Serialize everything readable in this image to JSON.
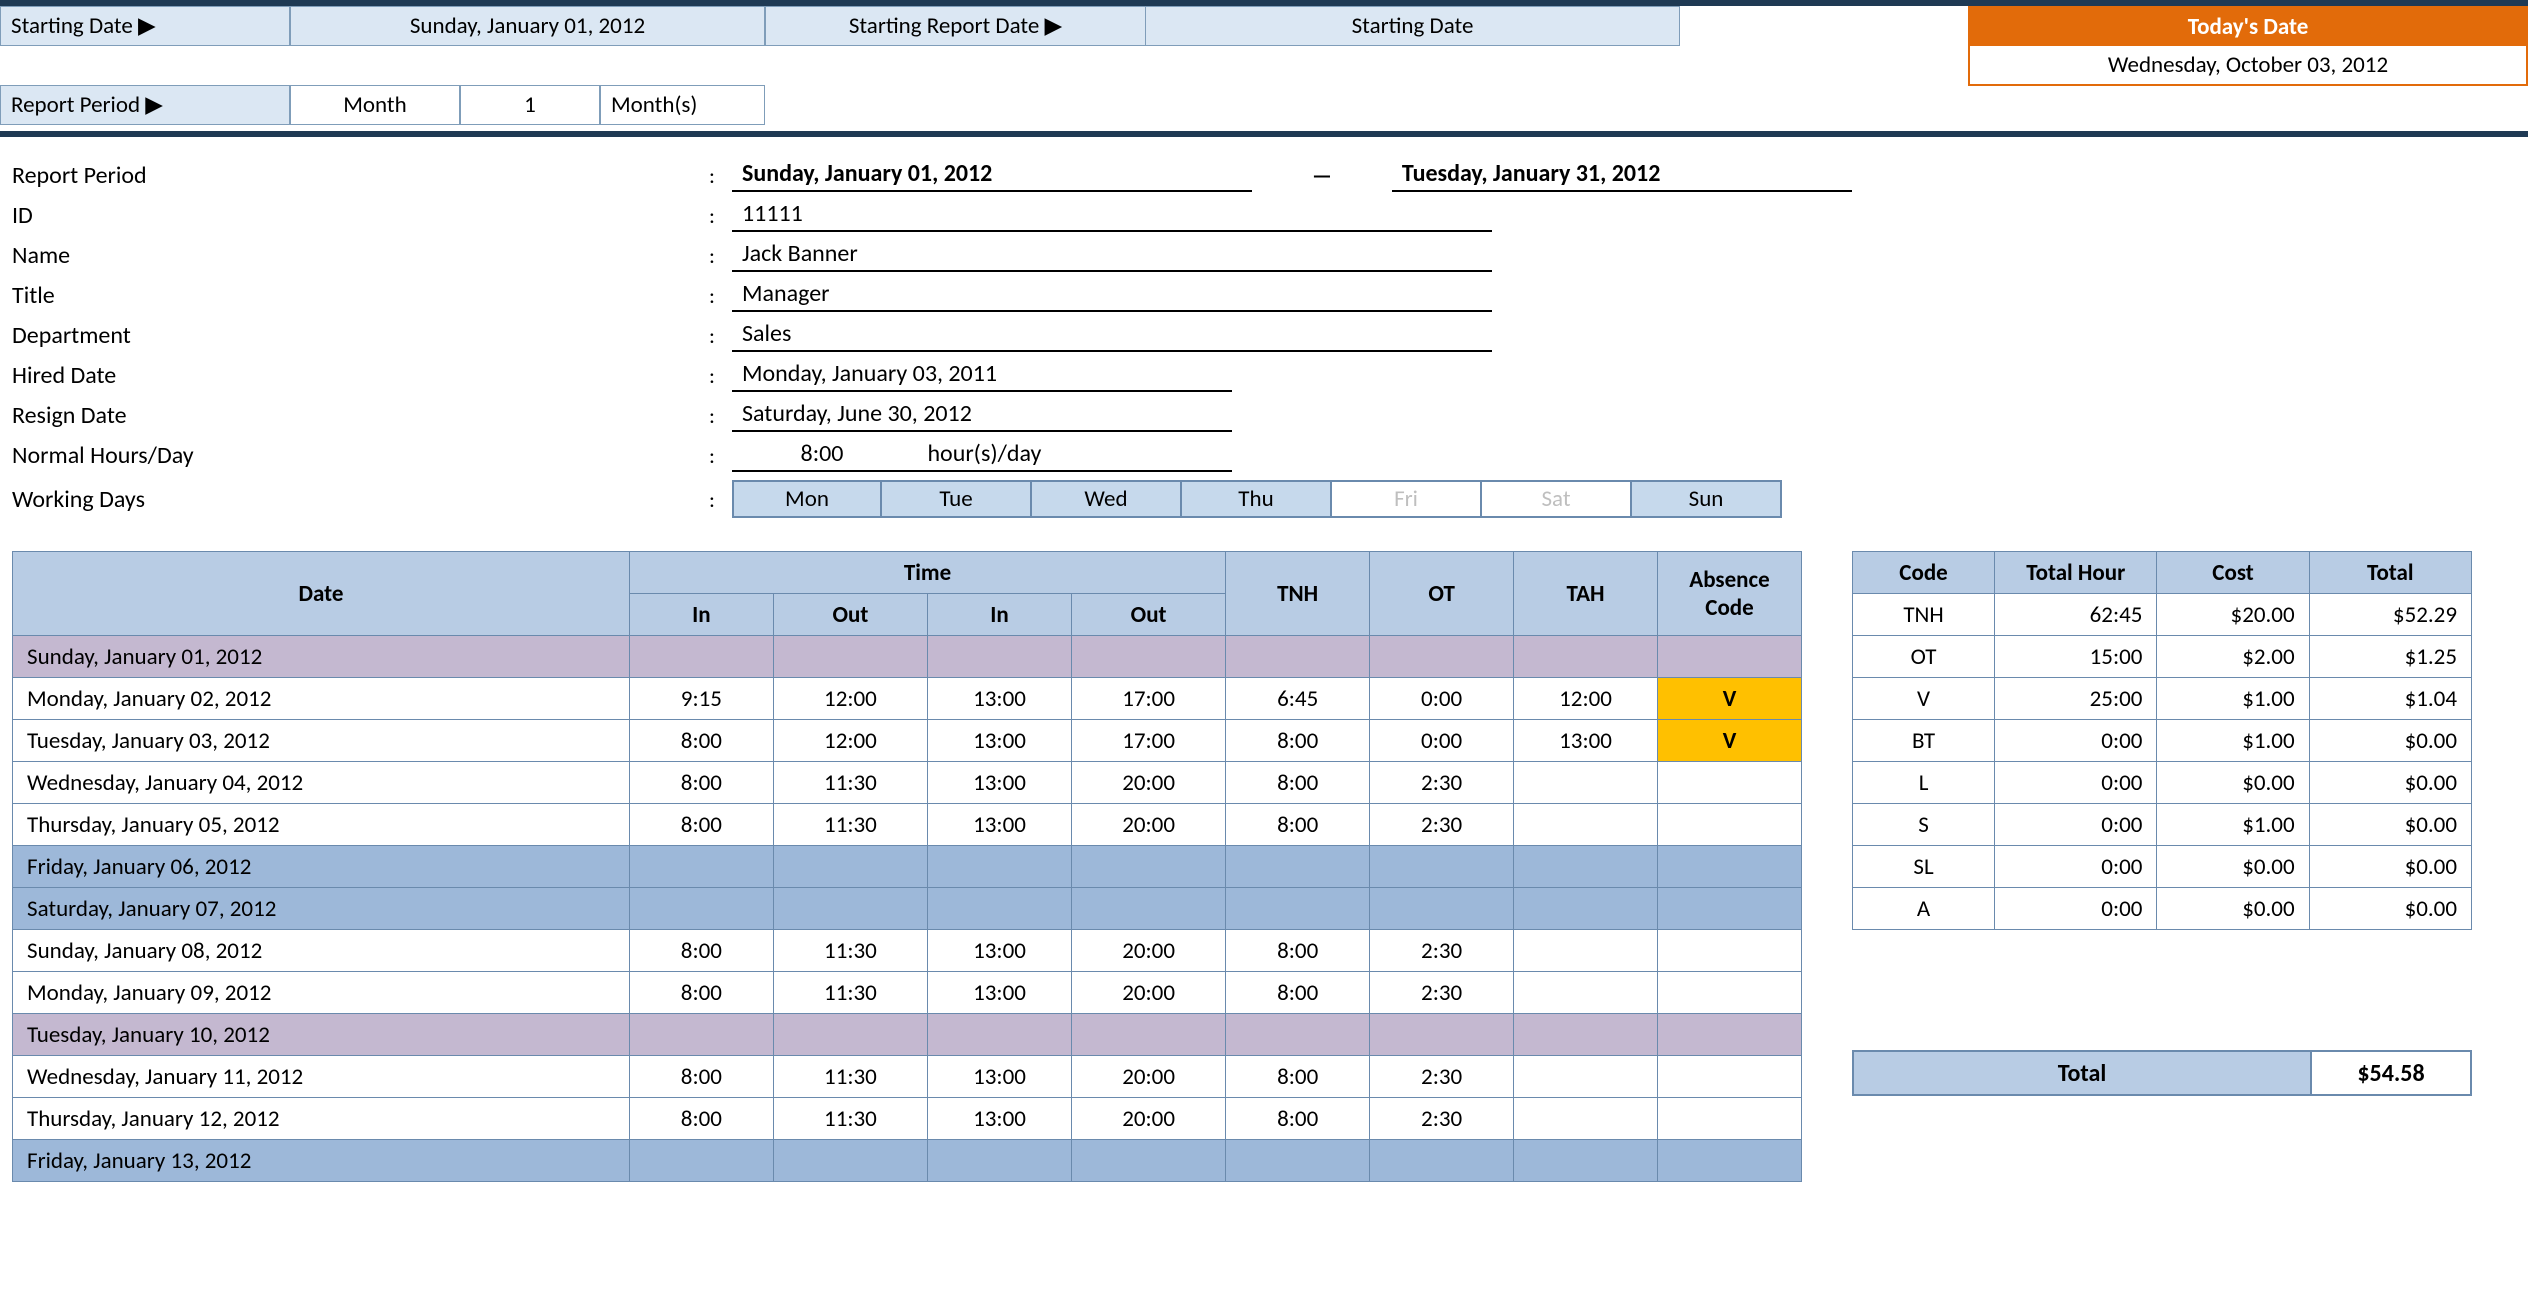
{
  "header": {
    "starting_date_label": "Starting Date ▶",
    "starting_date_value": "Sunday, January 01, 2012",
    "starting_report_date_label": "Starting Report Date ▶",
    "starting_report_date_value": "Starting Date",
    "report_period_label": "Report Period ▶",
    "report_period_month": "Month",
    "report_period_num": "1",
    "report_period_unit": "Month(s)",
    "today_label": "Today's Date",
    "today_value": "Wednesday, October 03, 2012"
  },
  "employee": {
    "report_period_label": "Report Period",
    "report_period_start": "Sunday, January 01, 2012",
    "report_period_dash": "—",
    "report_period_end": "Tuesday, January 31, 2012",
    "id_label": "ID",
    "id": "11111",
    "name_label": "Name",
    "name": "Jack Banner",
    "title_label": "Title",
    "title": "Manager",
    "dept_label": "Department",
    "dept": "Sales",
    "hired_label": "Hired Date",
    "hired": "Monday, January 03, 2011",
    "resign_label": "Resign Date",
    "resign": "Saturday, June 30, 2012",
    "nhd_label": "Normal Hours/Day",
    "nhd_hours": "8:00",
    "nhd_unit": "hour(s)/day",
    "wd_label": "Working Days",
    "days": {
      "mon": "Mon",
      "tue": "Tue",
      "wed": "Wed",
      "thu": "Thu",
      "fri": "Fri",
      "sat": "Sat",
      "sun": "Sun"
    }
  },
  "timesheet": {
    "headers": {
      "date": "Date",
      "time": "Time",
      "in": "In",
      "out": "Out",
      "tnh": "TNH",
      "ot": "OT",
      "tah": "TAH",
      "abs": "Absence Code"
    },
    "rows": [
      {
        "date": "Sunday, January 01, 2012",
        "style": "purple"
      },
      {
        "date": "Monday, January 02, 2012",
        "in1": "9:15",
        "out1": "12:00",
        "in2": "13:00",
        "out2": "17:00",
        "tnh": "6:45",
        "ot": "0:00",
        "tah": "12:00",
        "abs": "V"
      },
      {
        "date": "Tuesday, January 03, 2012",
        "in1": "8:00",
        "out1": "12:00",
        "in2": "13:00",
        "out2": "17:00",
        "tnh": "8:00",
        "ot": "0:00",
        "tah": "13:00",
        "abs": "V"
      },
      {
        "date": "Wednesday, January 04, 2012",
        "in1": "8:00",
        "out1": "11:30",
        "in2": "13:00",
        "out2": "20:00",
        "tnh": "8:00",
        "ot": "2:30"
      },
      {
        "date": "Thursday, January 05, 2012",
        "in1": "8:00",
        "out1": "11:30",
        "in2": "13:00",
        "out2": "20:00",
        "tnh": "8:00",
        "ot": "2:30"
      },
      {
        "date": "Friday, January 06, 2012",
        "style": "bluerow"
      },
      {
        "date": "Saturday, January 07, 2012",
        "style": "bluerow"
      },
      {
        "date": "Sunday, January 08, 2012",
        "in1": "8:00",
        "out1": "11:30",
        "in2": "13:00",
        "out2": "20:00",
        "tnh": "8:00",
        "ot": "2:30"
      },
      {
        "date": "Monday, January 09, 2012",
        "in1": "8:00",
        "out1": "11:30",
        "in2": "13:00",
        "out2": "20:00",
        "tnh": "8:00",
        "ot": "2:30"
      },
      {
        "date": "Tuesday, January 10, 2012",
        "style": "purple"
      },
      {
        "date": "Wednesday, January 11, 2012",
        "in1": "8:00",
        "out1": "11:30",
        "in2": "13:00",
        "out2": "20:00",
        "tnh": "8:00",
        "ot": "2:30"
      },
      {
        "date": "Thursday, January 12, 2012",
        "in1": "8:00",
        "out1": "11:30",
        "in2": "13:00",
        "out2": "20:00",
        "tnh": "8:00",
        "ot": "2:30"
      },
      {
        "date": "Friday, January 13, 2012",
        "style": "bluerow"
      }
    ]
  },
  "summary": {
    "headers": {
      "code": "Code",
      "hour": "Total Hour",
      "cost": "Cost",
      "total": "Total"
    },
    "rows": [
      {
        "code": "TNH",
        "hour": "62:45",
        "cost": "$20.00",
        "total": "$52.29"
      },
      {
        "code": "OT",
        "hour": "15:00",
        "cost": "$2.00",
        "total": "$1.25"
      },
      {
        "code": "V",
        "hour": "25:00",
        "cost": "$1.00",
        "total": "$1.04"
      },
      {
        "code": "BT",
        "hour": "0:00",
        "cost": "$1.00",
        "total": "$0.00"
      },
      {
        "code": "L",
        "hour": "0:00",
        "cost": "$0.00",
        "total": "$0.00"
      },
      {
        "code": "S",
        "hour": "0:00",
        "cost": "$1.00",
        "total": "$0.00"
      },
      {
        "code": "SL",
        "hour": "0:00",
        "cost": "$0.00",
        "total": "$0.00"
      },
      {
        "code": "A",
        "hour": "0:00",
        "cost": "$0.00",
        "total": "$0.00"
      }
    ],
    "grand_label": "Total",
    "grand_value": "$54.58"
  }
}
